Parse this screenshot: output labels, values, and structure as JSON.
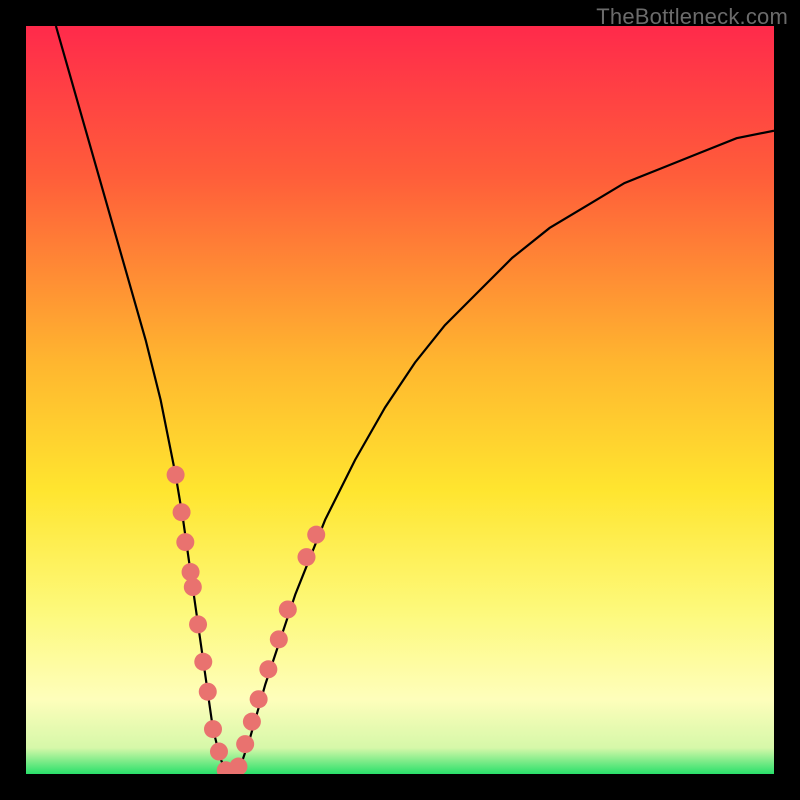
{
  "watermark": "TheBottleneck.com",
  "chart_data": {
    "type": "line",
    "title": "",
    "xlabel": "",
    "ylabel": "",
    "xlim": [
      0,
      100
    ],
    "ylim": [
      0,
      100
    ],
    "grid": false,
    "legend": false,
    "gradient_stops": [
      {
        "at": 0.0,
        "color": "#ff2a4b"
      },
      {
        "at": 0.2,
        "color": "#ff5d3a"
      },
      {
        "at": 0.45,
        "color": "#ffb62f"
      },
      {
        "at": 0.62,
        "color": "#ffe52f"
      },
      {
        "at": 0.78,
        "color": "#fdf97a"
      },
      {
        "at": 0.9,
        "color": "#fefebb"
      },
      {
        "at": 0.965,
        "color": "#d6f8a9"
      },
      {
        "at": 1.0,
        "color": "#29e06a"
      }
    ],
    "series": [
      {
        "name": "bottleneck-curve",
        "x": [
          4,
          6,
          8,
          10,
          12,
          14,
          16,
          18,
          20,
          21,
          22,
          23,
          24,
          25,
          26,
          27,
          28,
          29,
          30,
          32,
          34,
          36,
          38,
          40,
          44,
          48,
          52,
          56,
          60,
          65,
          70,
          75,
          80,
          85,
          90,
          95,
          100
        ],
        "y": [
          100,
          93,
          86,
          79,
          72,
          65,
          58,
          50,
          40,
          34,
          27,
          20,
          13,
          6,
          2,
          0,
          0,
          2,
          5,
          12,
          18,
          24,
          29,
          34,
          42,
          49,
          55,
          60,
          64,
          69,
          73,
          76,
          79,
          81,
          83,
          85,
          86
        ]
      }
    ],
    "highlight_points": {
      "color": "#e9726f",
      "radius_px": 9,
      "points": [
        {
          "x": 20.0,
          "y": 40
        },
        {
          "x": 20.8,
          "y": 35
        },
        {
          "x": 21.3,
          "y": 31
        },
        {
          "x": 22.0,
          "y": 27
        },
        {
          "x": 22.3,
          "y": 25
        },
        {
          "x": 23.0,
          "y": 20
        },
        {
          "x": 23.7,
          "y": 15
        },
        {
          "x": 24.3,
          "y": 11
        },
        {
          "x": 25.0,
          "y": 6
        },
        {
          "x": 25.8,
          "y": 3
        },
        {
          "x": 26.7,
          "y": 0.5
        },
        {
          "x": 27.5,
          "y": 0
        },
        {
          "x": 28.4,
          "y": 1
        },
        {
          "x": 29.3,
          "y": 4
        },
        {
          "x": 30.2,
          "y": 7
        },
        {
          "x": 31.1,
          "y": 10
        },
        {
          "x": 32.4,
          "y": 14
        },
        {
          "x": 33.8,
          "y": 18
        },
        {
          "x": 35.0,
          "y": 22
        },
        {
          "x": 37.5,
          "y": 29
        },
        {
          "x": 38.8,
          "y": 32
        }
      ]
    }
  }
}
